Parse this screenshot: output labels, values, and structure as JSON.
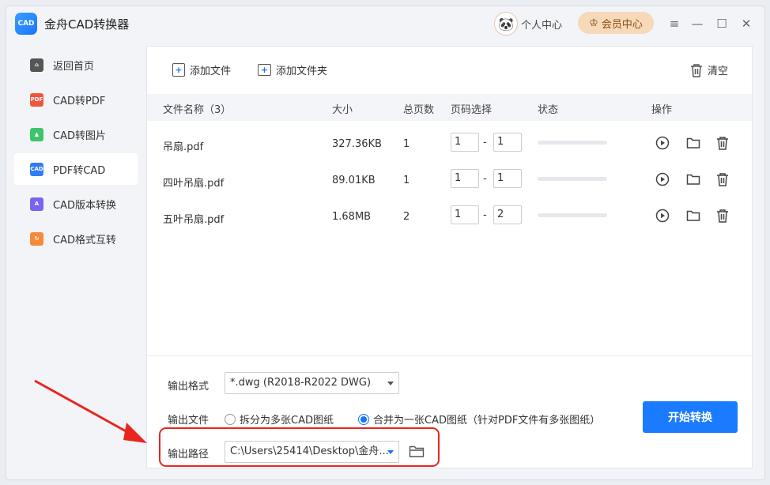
{
  "app": {
    "title": "金舟CAD转换器",
    "logo_text": "CAD"
  },
  "header": {
    "user_center": "个人中心",
    "member_center": "会员中心"
  },
  "sidebar": {
    "items": [
      {
        "label": "返回首页",
        "icon": "home-icon",
        "color": "#555555"
      },
      {
        "label": "CAD转PDF",
        "icon": "pdf-icon",
        "color": "#f0553f"
      },
      {
        "label": "CAD转图片",
        "icon": "image-icon",
        "color": "#3fc46b"
      },
      {
        "label": "PDF转CAD",
        "icon": "cad-icon",
        "color": "#2f7cf6"
      },
      {
        "label": "CAD版本转换",
        "icon": "version-icon",
        "color": "#7a63f2"
      },
      {
        "label": "CAD格式互转",
        "icon": "format-icon",
        "color": "#f58a3a"
      }
    ],
    "active_index": 3
  },
  "toolbar": {
    "add_file": "添加文件",
    "add_folder": "添加文件夹",
    "clear": "清空"
  },
  "table": {
    "headers": {
      "name": "文件名称（3）",
      "size": "大小",
      "pages": "总页数",
      "range": "页码选择",
      "status": "状态",
      "actions": "操作"
    },
    "rows": [
      {
        "name": "吊扇.pdf",
        "size": "327.36KB",
        "pages": "1",
        "from": "1",
        "to": "1",
        "progress": 0
      },
      {
        "name": "四叶吊扇.pdf",
        "size": "89.01KB",
        "pages": "1",
        "from": "1",
        "to": "1",
        "progress": 0
      },
      {
        "name": "五叶吊扇.pdf",
        "size": "1.68MB",
        "pages": "2",
        "from": "1",
        "to": "2",
        "progress": 0
      }
    ],
    "range_separator": "-"
  },
  "output": {
    "format_label": "输出格式",
    "format_value": "*.dwg (R2018-R2022 DWG)",
    "file_label": "输出文件",
    "option_split": "拆分为多张CAD图纸",
    "option_merge": "合并为一张CAD图纸（针对PDF文件有多张图纸）",
    "selected_option": "merge",
    "path_label": "输出路径",
    "path_value": "C:\\Users\\25414\\Desktop\\金舟...",
    "start_button": "开始转换"
  },
  "colors": {
    "accent": "#1a7bff",
    "annotation": "#e8261f",
    "member_bg": "#f5d9b8"
  }
}
